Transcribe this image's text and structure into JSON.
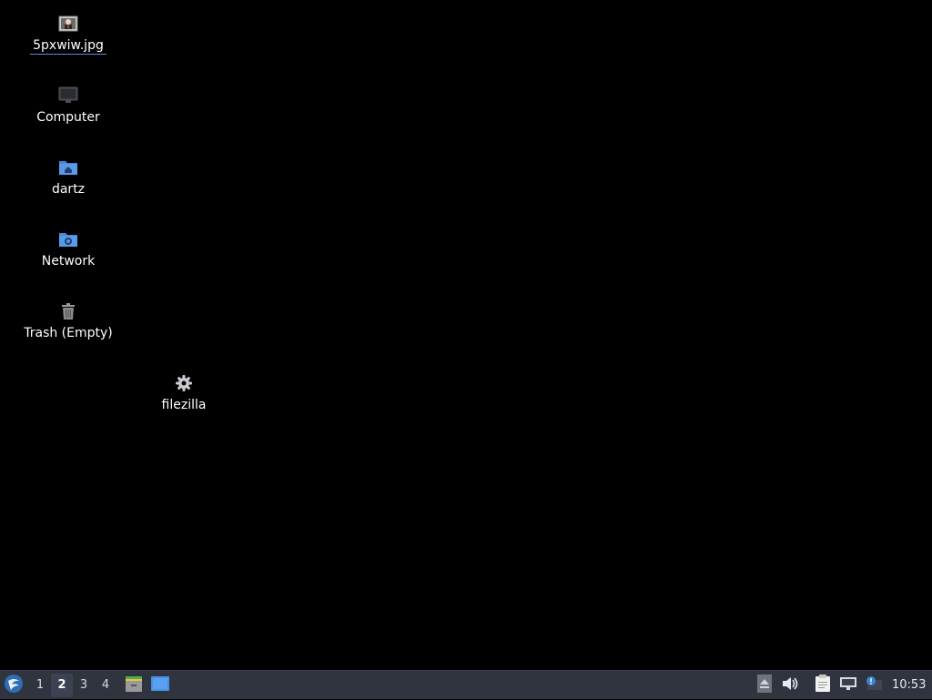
{
  "desktop": {
    "background": "#000000",
    "icons": [
      {
        "name": "5pxwiw.jpg",
        "type": "image",
        "selected": true
      },
      {
        "name": "Computer",
        "type": "computer"
      },
      {
        "name": "dartz",
        "type": "home-folder"
      },
      {
        "name": "Network",
        "type": "network-folder"
      },
      {
        "name": "Trash (Empty)",
        "type": "trash"
      },
      {
        "name": "filezilla",
        "type": "application"
      }
    ]
  },
  "taskbar": {
    "background": "#2f343f",
    "menu_icon": "distro-menu-icon",
    "workspaces": [
      "1",
      "2",
      "3",
      "4"
    ],
    "active_workspace": "2",
    "launchers": [
      "file-manager-icon",
      "show-desktop-icon"
    ],
    "tray": [
      "eject-icon",
      "volume-icon",
      "clipboard-icon",
      "network-icon",
      "update-notifier-icon"
    ],
    "clock": "10:53"
  }
}
